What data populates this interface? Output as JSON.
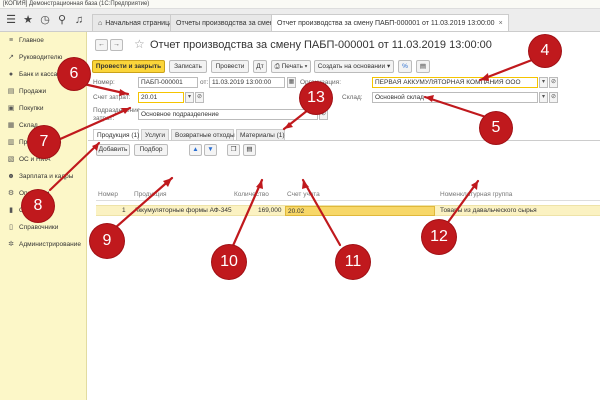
{
  "window": {
    "title": "[КОПИЯ] Демонстрационная база  (1С:Предприятие)"
  },
  "toolbar": {
    "icons": [
      "menu-icon",
      "star-icon",
      "history-icon",
      "search-icon",
      "bell-icon"
    ],
    "tabs": [
      {
        "label": "Начальная страница",
        "icon": "home-icon"
      },
      {
        "label": "Отчеты производства за смену",
        "icon": ""
      },
      {
        "label": "Отчет производства за смену ПАБП-000001 от 11.03.2019 13:00:00",
        "icon": ""
      }
    ]
  },
  "sidebar": {
    "items": [
      {
        "label": "Главное",
        "icon": "list-icon"
      },
      {
        "label": "Руководителю",
        "icon": "chart-icon"
      },
      {
        "label": "Банк и касса",
        "icon": "bank-icon"
      },
      {
        "label": "Продажи",
        "icon": "sales-icon"
      },
      {
        "label": "Покупки",
        "icon": "cart-icon"
      },
      {
        "label": "Склад",
        "icon": "warehouse-icon"
      },
      {
        "label": "Производство",
        "icon": "factory-icon"
      },
      {
        "label": "ОС и НМА",
        "icon": "asset-icon"
      },
      {
        "label": "Зарплата и кадры",
        "icon": "people-icon"
      },
      {
        "label": "Операции",
        "icon": "ops-icon"
      },
      {
        "label": "Отчеты",
        "icon": "report-icon"
      },
      {
        "label": "Справочники",
        "icon": "book-icon"
      },
      {
        "label": "Администрирование",
        "icon": "gear-icon"
      }
    ]
  },
  "page": {
    "title": "Отчет производства за смену ПАБП-000001 от 11.03.2019 13:00:00",
    "nav_back": "←",
    "nav_forward": "→"
  },
  "commands": {
    "post_close": "Провести и закрыть",
    "save": "Записать",
    "post": "Провести",
    "print": "Печать",
    "create_based": "Создать на основании"
  },
  "header": {
    "number_label": "Номер:",
    "number_value": "ПАБП-000001",
    "date_label": "от:",
    "date_value": "11.03.2019 13:00:00",
    "org_label": "Организация:",
    "org_value": "ПЕРВАЯ АККУМУЛЯТОРНАЯ КОМПАНИЯ ООО",
    "account_label": "Счет затрат:",
    "account_value": "20.01",
    "warehouse_label": "Склад:",
    "warehouse_value": "Основной склад",
    "division_label1": "Подразделение",
    "division_label2": "затрат:",
    "division_value": "Основное подразделение"
  },
  "form_tabs": [
    {
      "label": "Продукция (1)"
    },
    {
      "label": "Услуги"
    },
    {
      "label": "Возвратные отходы"
    },
    {
      "label": "Материалы (1)"
    }
  ],
  "table_toolbar": {
    "add": "Добавить",
    "pick": "Подбор"
  },
  "grid": {
    "columns": [
      "Номер",
      "Продукция",
      "Количество",
      "Счет учета",
      "Номенклатурная группа"
    ],
    "rows": [
      {
        "num": "1",
        "product": "Аккумуляторные формы АФ-345",
        "qty": "169,000",
        "account": "20.02",
        "group": "Товары из давальческого сырья"
      }
    ]
  },
  "callouts": [
    "4",
    "5",
    "6",
    "7",
    "8",
    "9",
    "10",
    "11",
    "12",
    "13"
  ],
  "colors": {
    "accent": "#fbd53a",
    "sidebar": "#fcf7c8",
    "callout": "#c0191d",
    "selection": "#fbf2c2"
  }
}
